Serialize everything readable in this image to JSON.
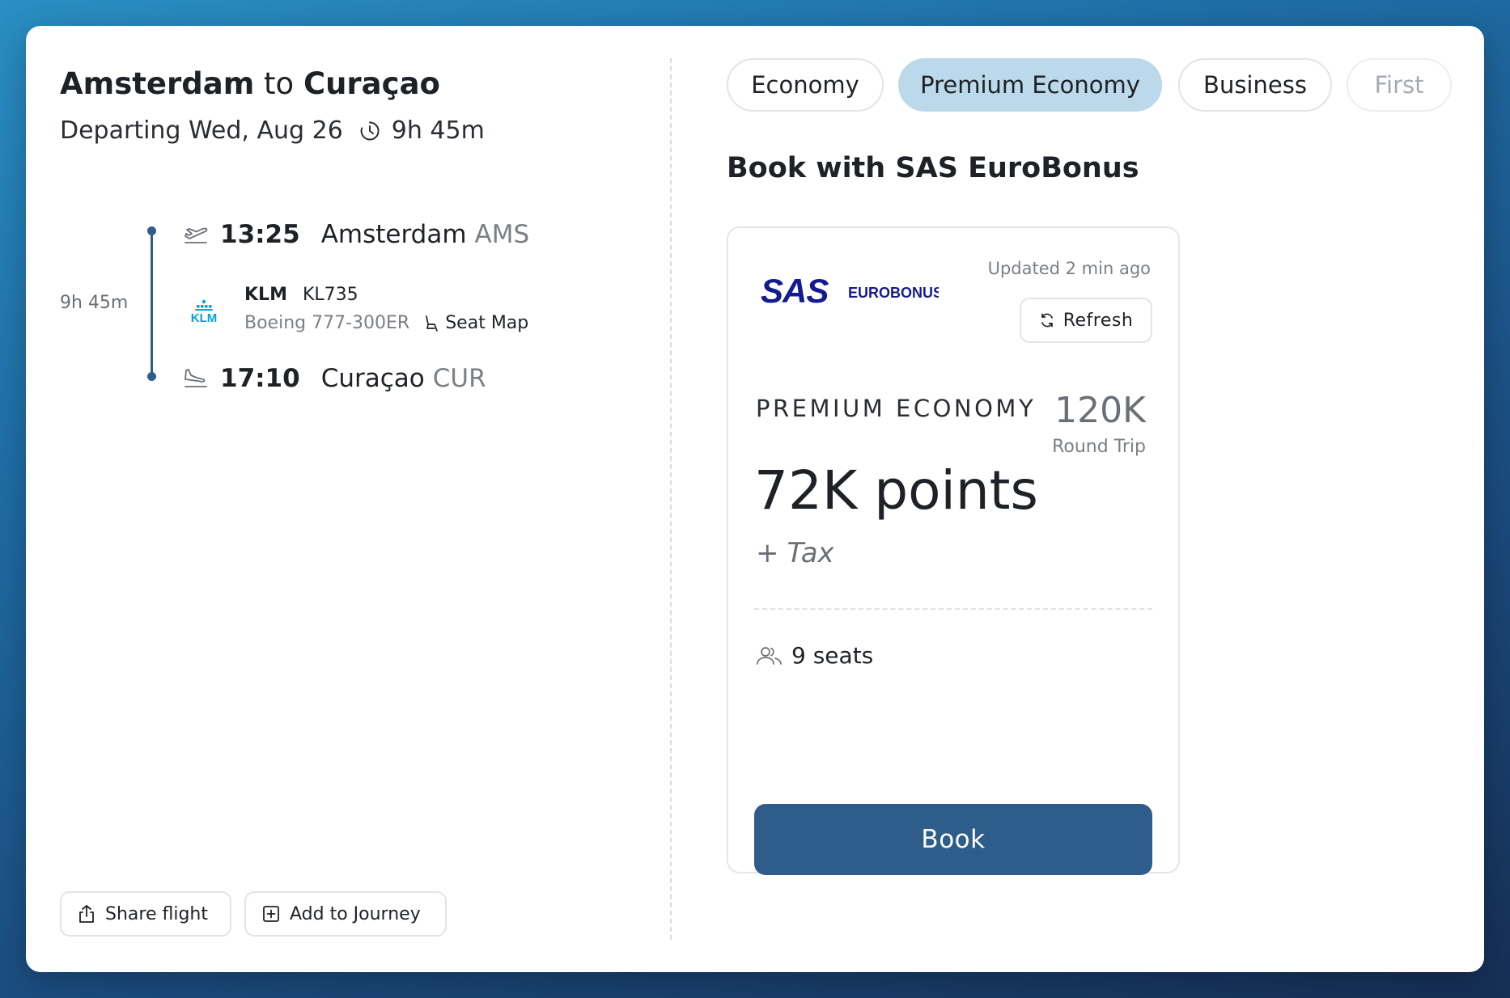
{
  "route": {
    "origin": "Amsterdam",
    "connector": "to",
    "destination": "Curaçao",
    "departing": "Departing Wed, Aug 26",
    "total_duration": "9h 45m"
  },
  "timeline": {
    "segment_duration": "9h 45m",
    "departure": {
      "time": "13:25",
      "city": "Amsterdam",
      "code": "AMS"
    },
    "flight": {
      "airline": "KLM",
      "flight_number": "KL735",
      "aircraft": "Boeing 777-300ER",
      "seat_map_label": "Seat Map",
      "logo_text": "KLM"
    },
    "arrival": {
      "time": "17:10",
      "city": "Curaçao",
      "code": "CUR"
    }
  },
  "actions": {
    "share": "Share flight",
    "add_journey": "Add to Journey"
  },
  "cabins": {
    "economy": "Economy",
    "premium": "Premium Economy",
    "business": "Business",
    "first": "First",
    "selected": "Premium Economy"
  },
  "booking": {
    "heading": "Book with SAS EuroBonus",
    "program_logo": {
      "brand": "SAS",
      "program": "EUROBONUS"
    },
    "updated": "Updated 2 min ago",
    "refresh": "Refresh",
    "cabin_label": "PREMIUM ECONOMY",
    "round_trip_points": "120K",
    "round_trip_label": "Round Trip",
    "points": "72K points",
    "tax_plus": "+",
    "tax": "Tax",
    "seats": "9 seats",
    "book": "Book"
  },
  "colors": {
    "primary": "#2e5c8b",
    "selected_tab": "#bcd9ec",
    "sas_blue": "#141b8e",
    "klm_blue": "#00a1de"
  }
}
